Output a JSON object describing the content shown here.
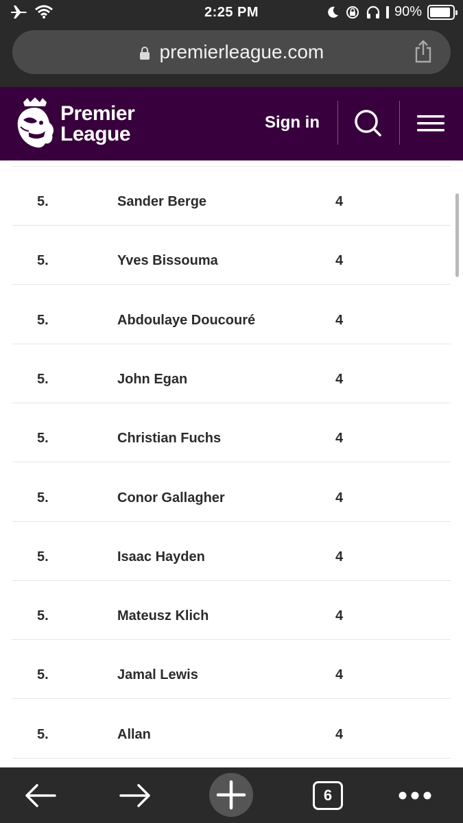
{
  "status_bar": {
    "time": "2:25 PM",
    "battery_text": "90%",
    "battery_level": 0.9,
    "icons": [
      "airplane-icon",
      "wifi-icon",
      "moon-icon",
      "rotation-lock-icon",
      "headphones-icon",
      "battery-icon"
    ]
  },
  "browser": {
    "url": "premierleague.com",
    "tab_count": "6"
  },
  "header": {
    "logo_line1": "Premier",
    "logo_line2": "League",
    "sign_in": "Sign in",
    "brand_color": "#38003c"
  },
  "table": {
    "rows": [
      {
        "rank": "5.",
        "name": "Sander Berge",
        "value": "4"
      },
      {
        "rank": "5.",
        "name": "Yves Bissouma",
        "value": "4"
      },
      {
        "rank": "5.",
        "name": "Abdoulaye Doucouré",
        "value": "4"
      },
      {
        "rank": "5.",
        "name": "John Egan",
        "value": "4"
      },
      {
        "rank": "5.",
        "name": "Christian Fuchs",
        "value": "4"
      },
      {
        "rank": "5.",
        "name": "Conor Gallagher",
        "value": "4"
      },
      {
        "rank": "5.",
        "name": "Isaac Hayden",
        "value": "4"
      },
      {
        "rank": "5.",
        "name": "Mateusz Klich",
        "value": "4"
      },
      {
        "rank": "5.",
        "name": "Jamal Lewis",
        "value": "4"
      },
      {
        "rank": "5.",
        "name": "Allan",
        "value": "4"
      }
    ]
  }
}
